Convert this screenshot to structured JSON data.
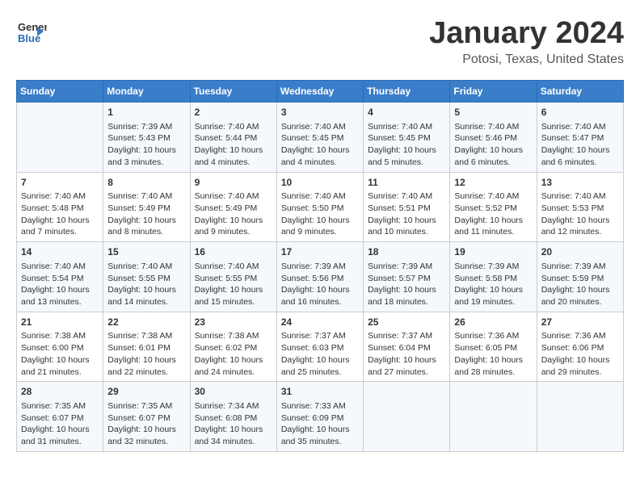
{
  "header": {
    "logo_general": "General",
    "logo_blue": "Blue",
    "title": "January 2024",
    "location": "Potosi, Texas, United States"
  },
  "columns": [
    "Sunday",
    "Monday",
    "Tuesday",
    "Wednesday",
    "Thursday",
    "Friday",
    "Saturday"
  ],
  "weeks": [
    [
      {
        "day": "",
        "content": ""
      },
      {
        "day": "1",
        "content": "Sunrise: 7:39 AM\nSunset: 5:43 PM\nDaylight: 10 hours\nand 3 minutes."
      },
      {
        "day": "2",
        "content": "Sunrise: 7:40 AM\nSunset: 5:44 PM\nDaylight: 10 hours\nand 4 minutes."
      },
      {
        "day": "3",
        "content": "Sunrise: 7:40 AM\nSunset: 5:45 PM\nDaylight: 10 hours\nand 4 minutes."
      },
      {
        "day": "4",
        "content": "Sunrise: 7:40 AM\nSunset: 5:45 PM\nDaylight: 10 hours\nand 5 minutes."
      },
      {
        "day": "5",
        "content": "Sunrise: 7:40 AM\nSunset: 5:46 PM\nDaylight: 10 hours\nand 6 minutes."
      },
      {
        "day": "6",
        "content": "Sunrise: 7:40 AM\nSunset: 5:47 PM\nDaylight: 10 hours\nand 6 minutes."
      }
    ],
    [
      {
        "day": "7",
        "content": "Sunrise: 7:40 AM\nSunset: 5:48 PM\nDaylight: 10 hours\nand 7 minutes."
      },
      {
        "day": "8",
        "content": "Sunrise: 7:40 AM\nSunset: 5:49 PM\nDaylight: 10 hours\nand 8 minutes."
      },
      {
        "day": "9",
        "content": "Sunrise: 7:40 AM\nSunset: 5:49 PM\nDaylight: 10 hours\nand 9 minutes."
      },
      {
        "day": "10",
        "content": "Sunrise: 7:40 AM\nSunset: 5:50 PM\nDaylight: 10 hours\nand 9 minutes."
      },
      {
        "day": "11",
        "content": "Sunrise: 7:40 AM\nSunset: 5:51 PM\nDaylight: 10 hours\nand 10 minutes."
      },
      {
        "day": "12",
        "content": "Sunrise: 7:40 AM\nSunset: 5:52 PM\nDaylight: 10 hours\nand 11 minutes."
      },
      {
        "day": "13",
        "content": "Sunrise: 7:40 AM\nSunset: 5:53 PM\nDaylight: 10 hours\nand 12 minutes."
      }
    ],
    [
      {
        "day": "14",
        "content": "Sunrise: 7:40 AM\nSunset: 5:54 PM\nDaylight: 10 hours\nand 13 minutes."
      },
      {
        "day": "15",
        "content": "Sunrise: 7:40 AM\nSunset: 5:55 PM\nDaylight: 10 hours\nand 14 minutes."
      },
      {
        "day": "16",
        "content": "Sunrise: 7:40 AM\nSunset: 5:55 PM\nDaylight: 10 hours\nand 15 minutes."
      },
      {
        "day": "17",
        "content": "Sunrise: 7:39 AM\nSunset: 5:56 PM\nDaylight: 10 hours\nand 16 minutes."
      },
      {
        "day": "18",
        "content": "Sunrise: 7:39 AM\nSunset: 5:57 PM\nDaylight: 10 hours\nand 18 minutes."
      },
      {
        "day": "19",
        "content": "Sunrise: 7:39 AM\nSunset: 5:58 PM\nDaylight: 10 hours\nand 19 minutes."
      },
      {
        "day": "20",
        "content": "Sunrise: 7:39 AM\nSunset: 5:59 PM\nDaylight: 10 hours\nand 20 minutes."
      }
    ],
    [
      {
        "day": "21",
        "content": "Sunrise: 7:38 AM\nSunset: 6:00 PM\nDaylight: 10 hours\nand 21 minutes."
      },
      {
        "day": "22",
        "content": "Sunrise: 7:38 AM\nSunset: 6:01 PM\nDaylight: 10 hours\nand 22 minutes."
      },
      {
        "day": "23",
        "content": "Sunrise: 7:38 AM\nSunset: 6:02 PM\nDaylight: 10 hours\nand 24 minutes."
      },
      {
        "day": "24",
        "content": "Sunrise: 7:37 AM\nSunset: 6:03 PM\nDaylight: 10 hours\nand 25 minutes."
      },
      {
        "day": "25",
        "content": "Sunrise: 7:37 AM\nSunset: 6:04 PM\nDaylight: 10 hours\nand 27 minutes."
      },
      {
        "day": "26",
        "content": "Sunrise: 7:36 AM\nSunset: 6:05 PM\nDaylight: 10 hours\nand 28 minutes."
      },
      {
        "day": "27",
        "content": "Sunrise: 7:36 AM\nSunset: 6:06 PM\nDaylight: 10 hours\nand 29 minutes."
      }
    ],
    [
      {
        "day": "28",
        "content": "Sunrise: 7:35 AM\nSunset: 6:07 PM\nDaylight: 10 hours\nand 31 minutes."
      },
      {
        "day": "29",
        "content": "Sunrise: 7:35 AM\nSunset: 6:07 PM\nDaylight: 10 hours\nand 32 minutes."
      },
      {
        "day": "30",
        "content": "Sunrise: 7:34 AM\nSunset: 6:08 PM\nDaylight: 10 hours\nand 34 minutes."
      },
      {
        "day": "31",
        "content": "Sunrise: 7:33 AM\nSunset: 6:09 PM\nDaylight: 10 hours\nand 35 minutes."
      },
      {
        "day": "",
        "content": ""
      },
      {
        "day": "",
        "content": ""
      },
      {
        "day": "",
        "content": ""
      }
    ]
  ]
}
